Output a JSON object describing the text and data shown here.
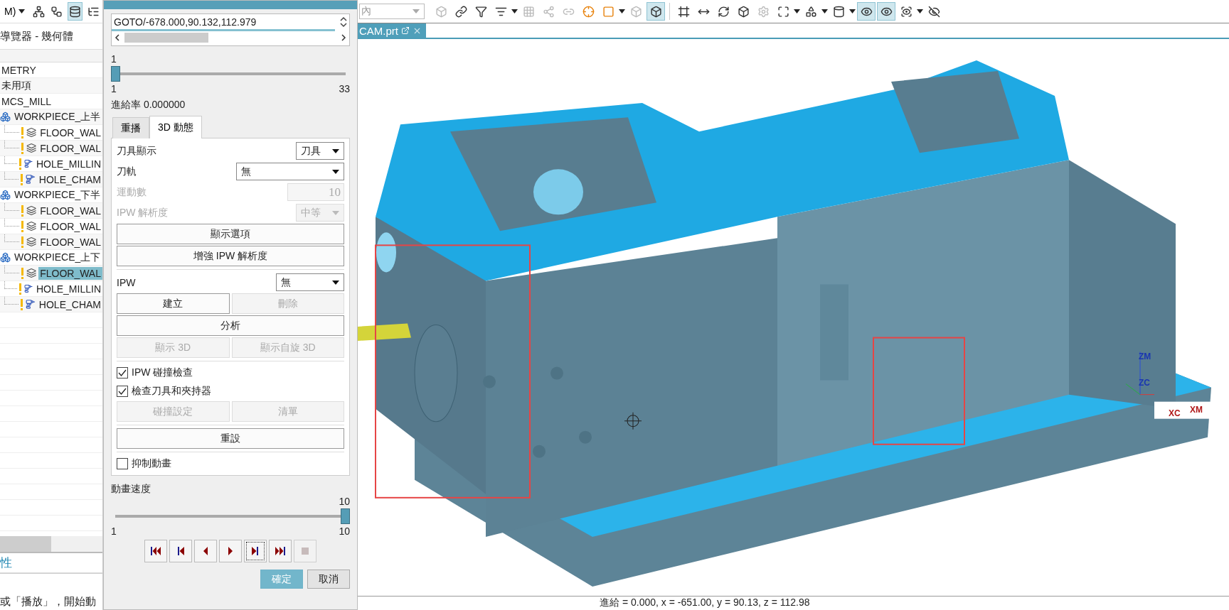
{
  "left_toolbar": {
    "menu_label": "M)",
    "icons": [
      {
        "kind": "network",
        "on": false
      },
      {
        "kind": "workflow",
        "on": false
      },
      {
        "kind": "database",
        "on": true
      },
      {
        "kind": "list-tree",
        "on": false
      }
    ]
  },
  "navigator": {
    "title": "導覽器 - 幾何體",
    "tree": [
      {
        "label": "METRY",
        "kind": "group"
      },
      {
        "label": "未用項",
        "kind": "group"
      },
      {
        "label": "MCS_MILL",
        "kind": "group"
      },
      {
        "label": "WORKPIECE_上半",
        "kind": "workpiece",
        "children": [
          {
            "label": "FLOOR_WAL",
            "kind": "floor_wall",
            "selected": false
          },
          {
            "label": "FLOOR_WAL",
            "kind": "floor_wall",
            "selected": false
          },
          {
            "label": "HOLE_MILLIN",
            "kind": "hole_milling",
            "selected": false
          },
          {
            "label": "HOLE_CHAM",
            "kind": "hole_chamfer",
            "selected": false
          }
        ]
      },
      {
        "label": "WORKPIECE_下半",
        "kind": "workpiece",
        "children": [
          {
            "label": "FLOOR_WAL",
            "kind": "floor_wall",
            "selected": false
          },
          {
            "label": "FLOOR_WAL",
            "kind": "floor_wall",
            "selected": false
          },
          {
            "label": "FLOOR_WAL",
            "kind": "floor_wall",
            "selected": false
          }
        ]
      },
      {
        "label": "WORKPIECE_上下",
        "kind": "workpiece",
        "children": [
          {
            "label": "FLOOR_WAL",
            "kind": "floor_wall",
            "selected": true
          },
          {
            "label": "HOLE_MILLIN",
            "kind": "hole_milling",
            "selected": false
          },
          {
            "label": "HOLE_CHAM",
            "kind": "hole_chamfer",
            "selected": false
          }
        ]
      }
    ],
    "properties_title": "性",
    "hint": "或「播放」，開始動"
  },
  "dialog": {
    "path_line": "GOTO/-678.000,90.132,112.979",
    "step": {
      "value": "1",
      "level": 0,
      "min": "1",
      "max": "33"
    },
    "feed_rate": "進給率 0.000000",
    "tabs": [
      {
        "label": "重播",
        "selected": false
      },
      {
        "label": "3D 動態",
        "selected": true
      }
    ],
    "rows": [
      {
        "kind": "select",
        "label": "刀具顯示",
        "value": "刀具",
        "disabled": false
      },
      {
        "kind": "wide_select",
        "label": "刀軌",
        "value": "無",
        "disabled": false
      },
      {
        "kind": "number",
        "label": "運動數",
        "value": "10",
        "disabled": true
      },
      {
        "kind": "select",
        "label": "IPW 解析度",
        "value": "中等",
        "disabled": true
      },
      {
        "kind": "button",
        "label": "顯示選項",
        "disabled": false
      },
      {
        "kind": "button",
        "label": "增強 IPW 解析度",
        "disabled": false
      },
      {
        "kind": "divider"
      },
      {
        "kind": "medium_select",
        "label": "IPW",
        "value": "無",
        "disabled": false
      },
      {
        "kind": "pair",
        "buttons": [
          {
            "label": "建立",
            "disabled": false
          },
          {
            "label": "刪除",
            "disabled": true
          }
        ]
      },
      {
        "kind": "button",
        "label": "分析",
        "disabled": false
      },
      {
        "kind": "pair",
        "buttons": [
          {
            "label": "顯示 3D",
            "disabled": true
          },
          {
            "label": "顯示自旋 3D",
            "disabled": true
          }
        ]
      },
      {
        "kind": "divider"
      },
      {
        "kind": "checkbox",
        "label": "IPW 碰撞檢查",
        "checked": true
      },
      {
        "kind": "checkbox",
        "label": "檢查刀具和夾持器",
        "checked": true
      },
      {
        "kind": "pair",
        "buttons": [
          {
            "label": "碰撞設定",
            "disabled": true
          },
          {
            "label": "清單",
            "disabled": true
          }
        ]
      },
      {
        "kind": "divider"
      },
      {
        "kind": "button",
        "label": "重設",
        "disabled": false
      },
      {
        "kind": "divider"
      },
      {
        "kind": "checkbox",
        "label": "抑制動畫",
        "checked": false
      }
    ],
    "speed": {
      "label": "動畫速度",
      "value": "10",
      "level": 1,
      "min": "1",
      "max": "10"
    },
    "playback": [
      {
        "kind": "first",
        "disabled": false,
        "focused": false
      },
      {
        "kind": "step-back",
        "disabled": false,
        "focused": false
      },
      {
        "kind": "play-back",
        "disabled": false,
        "focused": false
      },
      {
        "kind": "play",
        "disabled": false,
        "focused": false
      },
      {
        "kind": "step-forward",
        "disabled": false,
        "focused": true
      },
      {
        "kind": "last",
        "disabled": false,
        "focused": false
      },
      {
        "kind": "stop",
        "disabled": true,
        "focused": false
      }
    ],
    "footer": [
      {
        "label": "確定",
        "primary": true
      },
      {
        "label": "取消",
        "primary": false
      }
    ]
  },
  "main_toolbar": {
    "filter_value": "內",
    "icons": [
      {
        "kind": "cube",
        "on": false,
        "disabled": true
      },
      {
        "kind": "link",
        "on": false,
        "disabled": false
      },
      {
        "kind": "funnel",
        "on": false,
        "disabled": false
      },
      {
        "kind": "funnel-list",
        "on": false,
        "disabled": false
      },
      {
        "kind": "caret"
      },
      {
        "kind": "grid",
        "on": false,
        "disabled": true
      },
      {
        "kind": "nodes",
        "on": false,
        "disabled": true
      },
      {
        "kind": "chain",
        "on": false,
        "disabled": true
      },
      {
        "kind": "crosshair",
        "on": false,
        "disabled": false
      },
      {
        "kind": "square",
        "on": false,
        "disabled": false
      },
      {
        "kind": "caret"
      },
      {
        "kind": "cube",
        "on": false,
        "disabled": true
      },
      {
        "kind": "cube",
        "on": true,
        "disabled": false
      },
      {
        "kind": "sep"
      },
      {
        "kind": "frame",
        "on": false,
        "disabled": false
      },
      {
        "kind": "arrows",
        "on": false,
        "disabled": false
      },
      {
        "kind": "refresh",
        "on": false,
        "disabled": false
      },
      {
        "kind": "cube",
        "on": false,
        "disabled": false
      },
      {
        "kind": "gear",
        "on": false,
        "disabled": true
      },
      {
        "kind": "expand",
        "on": false,
        "disabled": false
      },
      {
        "kind": "caret"
      },
      {
        "kind": "shape",
        "on": false,
        "disabled": false
      },
      {
        "kind": "caret"
      },
      {
        "kind": "cylinder",
        "on": false,
        "disabled": false
      },
      {
        "kind": "caret"
      },
      {
        "kind": "eye",
        "on": true,
        "disabled": false
      },
      {
        "kind": "eye",
        "on": true,
        "disabled": false
      },
      {
        "kind": "scan-eye",
        "on": false,
        "disabled": false
      },
      {
        "kind": "caret"
      },
      {
        "kind": "eye-off",
        "on": false,
        "disabled": false
      }
    ]
  },
  "viewport": {
    "tab": "CAM.prt",
    "axes": [
      "ZM",
      "ZC",
      "XC",
      "XM"
    ],
    "status": "進給 = 0.000, x = -651.00, y = 90.13, z = 112.98"
  }
}
